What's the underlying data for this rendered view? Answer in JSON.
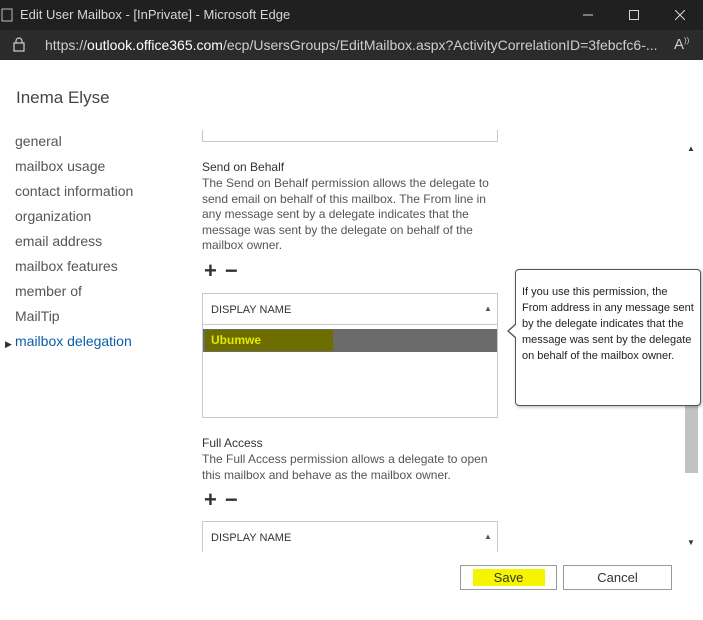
{
  "window": {
    "title": "Edit User Mailbox - [InPrivate] - Microsoft Edge",
    "url_prefix": "https://",
    "url_host": "outlook.office365.com",
    "url_path": "/ecp/UsersGroups/EditMailbox.aspx?ActivityCorrelationID=3febcfc6-..."
  },
  "page": {
    "title": "Inema Elyse"
  },
  "nav": {
    "items": [
      {
        "label": "general"
      },
      {
        "label": "mailbox usage"
      },
      {
        "label": "contact information"
      },
      {
        "label": "organization"
      },
      {
        "label": "email address"
      },
      {
        "label": "mailbox features"
      },
      {
        "label": "member of"
      },
      {
        "label": "MailTip"
      },
      {
        "label": "mailbox delegation"
      }
    ]
  },
  "send_on_behalf": {
    "title": "Send on Behalf",
    "description": "The Send on Behalf permission allows the delegate to send email on behalf of this mailbox. The From line in any message sent by a delegate indicates that the message was sent by the delegate on behalf of the mailbox owner.",
    "column_header": "DISPLAY NAME",
    "rows": [
      "Ubumwe"
    ]
  },
  "full_access": {
    "title": "Full Access",
    "description": "The Full Access permission allows a delegate to open this mailbox and behave as the mailbox owner.",
    "column_header": "DISPLAY NAME"
  },
  "tooltip": {
    "text": "If you use this permission, the From address in any message sent by the delegate indicates that the message was sent by the delegate on behalf of the mailbox owner."
  },
  "buttons": {
    "save": "Save",
    "cancel": "Cancel"
  },
  "colors": {
    "highlight": "#f5f500",
    "active_nav": "#0a5ea8",
    "titlebar": "#202020"
  }
}
